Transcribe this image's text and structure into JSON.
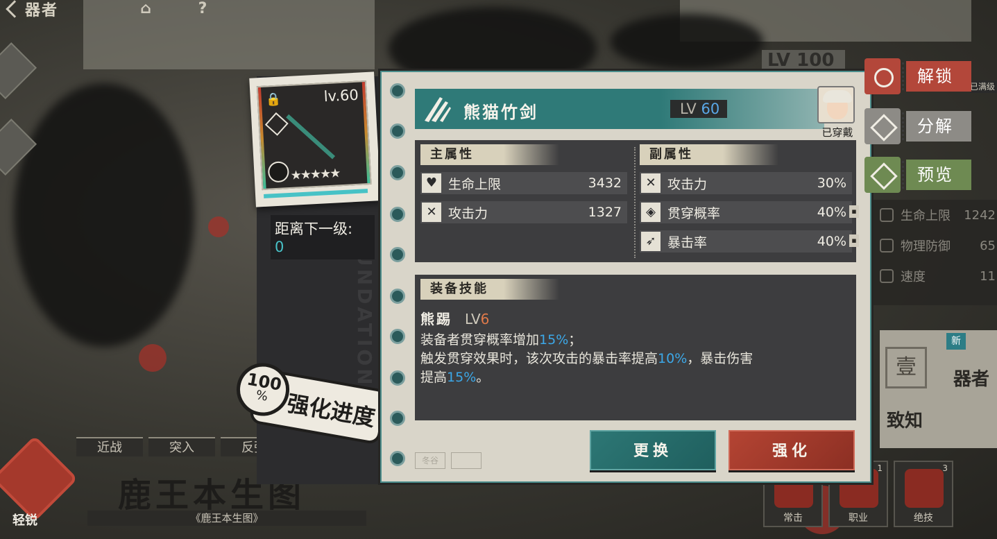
{
  "app": {
    "title": "器者"
  },
  "background": {
    "stage_title": "鹿王本生图",
    "stage_subtitle": "《鹿王本生图》",
    "badge_label": "轻锐",
    "tags": [
      "近战",
      "突入",
      "反弹"
    ],
    "right_stats": [
      {
        "icon": "heart-icon",
        "label": "生命上限",
        "value": "1242"
      },
      {
        "icon": "shield-icon",
        "label": "物理防御",
        "value": "65"
      },
      {
        "icon": "arrow-icon",
        "label": "速度",
        "value": "11"
      }
    ],
    "right_card": {
      "new_tag": "新",
      "seal": "壹",
      "name": "器者",
      "name2": "致知"
    },
    "skill_slots": [
      {
        "name": "常击",
        "num": ""
      },
      {
        "name": "职业",
        "num": "1"
      },
      {
        "name": "绝技",
        "num": "3"
      }
    ],
    "full_tag": "已满级"
  },
  "equipment_card": {
    "level_text": "lv.60",
    "stars": "★★★★★",
    "progress_fraction": 1.0,
    "next_level_label": "距离下一级:",
    "next_level_value": "0",
    "vertical_text": "FOUNDATION"
  },
  "progress_badge": {
    "percent_num": "100",
    "percent_sign": "%",
    "label": "强化进度"
  },
  "dialog": {
    "item_name": "熊猫竹剑",
    "level_prefix": "LV",
    "level_value": "60",
    "wearer_label": "已穿戴",
    "main_attr_title": "主属性",
    "main_attrs": [
      {
        "icon": "heart-icon",
        "name": "生命上限",
        "value": "3432"
      },
      {
        "icon": "sword-icon",
        "name": "攻击力",
        "value": "1327"
      }
    ],
    "sub_attr_title": "副属性",
    "sub_attrs": [
      {
        "icon": "sword-icon",
        "name": "攻击力",
        "value": "30%",
        "locked": false
      },
      {
        "icon": "pierce-icon",
        "name": "贯穿概率",
        "value": "40%",
        "locked": true
      },
      {
        "icon": "crit-icon",
        "name": "暴击率",
        "value": "40%",
        "locked": true
      }
    ],
    "skill_title": "装备技能",
    "skill_name": "熊踢",
    "skill_lv_prefix": "LV",
    "skill_lv": "6",
    "skill_desc": [
      [
        {
          "t": "装备者贯穿概率增加"
        },
        {
          "t": "15%",
          "hl": true
        },
        {
          "t": "；"
        }
      ],
      [
        {
          "t": "触发贯穿效果时，该次攻击的暴击率提高"
        },
        {
          "t": "10%",
          "hl": true
        },
        {
          "t": "，暴击伤害"
        }
      ],
      [
        {
          "t": "提高"
        },
        {
          "t": "15%",
          "hl": true
        },
        {
          "t": "。"
        }
      ]
    ],
    "replace_label": "更换",
    "enhance_label": "强化"
  },
  "side_actions": {
    "unlock": "解锁",
    "dismantle": "分解",
    "preview": "预览"
  },
  "colors": {
    "teal": "#2f7a78",
    "red": "#b44433",
    "highlight_blue": "#3ca8e8",
    "level_orange": "#e07a4a"
  }
}
